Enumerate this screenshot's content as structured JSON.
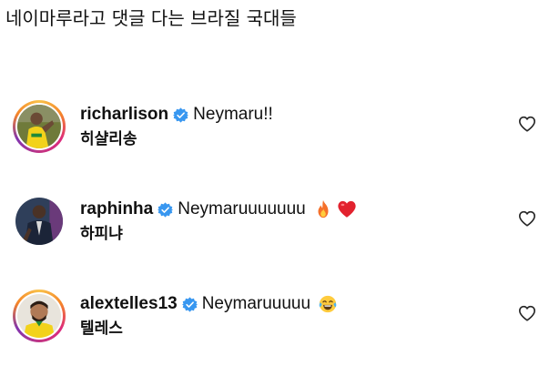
{
  "post": {
    "title": "네이마루라고 댓글 다는 브라질 국대들"
  },
  "comments": [
    {
      "username": "richarlison",
      "text": "Neymaru!!",
      "emojis": [],
      "translation": "히샬리송",
      "avatar_story_ring": true,
      "verified": true
    },
    {
      "username": "raphinha",
      "text": "Neymaruuuuuuu",
      "emojis": [
        "fire-emoji",
        "red-heart-emoji"
      ],
      "translation": "하피냐",
      "avatar_story_ring": false,
      "verified": true
    },
    {
      "username": "alextelles13",
      "text": "Neymaruuuuu",
      "emojis": [
        "tears-of-joy-emoji"
      ],
      "translation": "텔레스",
      "avatar_story_ring": true,
      "verified": true
    }
  ],
  "icons": {
    "verified_badge": "verified-badge-icon",
    "like": "heart-outline-icon"
  },
  "colors": {
    "verified_blue": "#3897f0",
    "story_ring_start": "#f9c24a",
    "story_ring_end": "#c13584",
    "text": "#111111",
    "like_outline": "#262626"
  }
}
